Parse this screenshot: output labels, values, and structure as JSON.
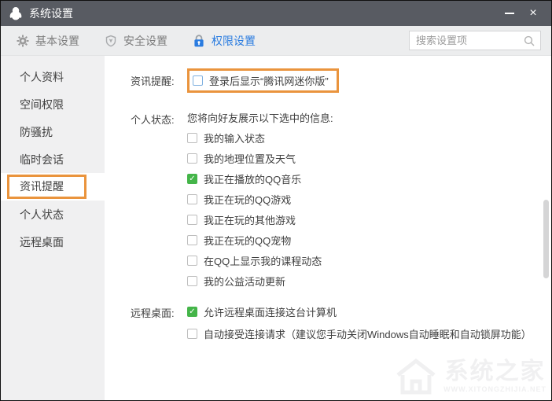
{
  "window": {
    "title": "系统设置",
    "close_glyph": "×"
  },
  "tabs": [
    {
      "label": "基本设置",
      "icon": "gear-icon",
      "active": false
    },
    {
      "label": "安全设置",
      "icon": "shield-icon",
      "active": false
    },
    {
      "label": "权限设置",
      "icon": "lock-icon",
      "active": true
    }
  ],
  "search": {
    "placeholder": "搜索设置项"
  },
  "sidebar": {
    "items": [
      {
        "label": "个人资料",
        "active": false
      },
      {
        "label": "空间权限",
        "active": false
      },
      {
        "label": "防骚扰",
        "active": false
      },
      {
        "label": "临时会话",
        "active": false
      },
      {
        "label": "资讯提醒",
        "active": true
      },
      {
        "label": "个人状态",
        "active": false
      },
      {
        "label": "远程桌面",
        "active": false
      }
    ]
  },
  "sections": [
    {
      "label": "资讯提醒:",
      "rows": [
        {
          "text": "登录后显示“腾讯网迷你版”",
          "checked": false,
          "highlighted": true,
          "blue": true
        }
      ]
    },
    {
      "label": "个人状态:",
      "intro": "您将向好友展示以下选中的信息:",
      "rows": [
        {
          "text": "我的输入状态",
          "checked": false
        },
        {
          "text": "我的地理位置及天气",
          "checked": false
        },
        {
          "text": "我正在播放的QQ音乐",
          "checked": true
        },
        {
          "text": "我正在玩的QQ游戏",
          "checked": false
        },
        {
          "text": "我正在玩的其他游戏",
          "checked": false
        },
        {
          "text": "我正在玩的QQ宠物",
          "checked": false
        },
        {
          "text": "在QQ上显示我的课程动态",
          "checked": false
        },
        {
          "text": "我的公益活动更新",
          "checked": false
        }
      ]
    },
    {
      "label": "远程桌面:",
      "rows": [
        {
          "text": "允许远程桌面连接这台计算机",
          "checked": true,
          "tall": true
        },
        {
          "text": "自动接受连接请求（建议您手动关闭Windows自动睡眠和自动锁屏功能）",
          "checked": false,
          "tall": true
        }
      ]
    }
  ],
  "icons": {
    "check": "✓"
  },
  "watermark": {
    "text": "系统之家",
    "url": "WWW.XITONGZHIJIA.NET"
  },
  "colors": {
    "accent_blue": "#2a7ce0",
    "highlight_orange": "#ea943d",
    "check_green": "#44b549",
    "titlebar": "#585b62"
  }
}
